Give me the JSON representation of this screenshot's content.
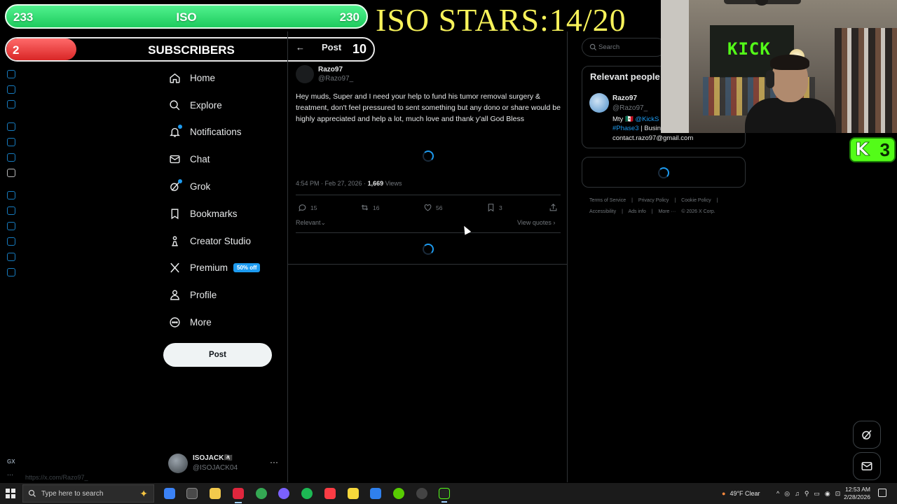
{
  "overlay": {
    "green_bar": {
      "left": "233",
      "center": "ISO",
      "right": "230"
    },
    "red_bar": {
      "left": "2",
      "center": "SUBSCRIBERS"
    },
    "stars_text": "ISO STARS:14/20",
    "kick_badge": {
      "count": "3"
    }
  },
  "header": {
    "back_icon": "arrow-left-icon",
    "title": "Post",
    "count": "10"
  },
  "nav": {
    "items": [
      {
        "label": "Home",
        "icon": "home-icon"
      },
      {
        "label": "Explore",
        "icon": "search-icon"
      },
      {
        "label": "Notifications",
        "icon": "bell-icon"
      },
      {
        "label": "Chat",
        "icon": "mail-icon"
      },
      {
        "label": "Grok",
        "icon": "grok-icon"
      },
      {
        "label": "Bookmarks",
        "icon": "bookmark-icon"
      },
      {
        "label": "Creator Studio",
        "icon": "creator-icon"
      },
      {
        "label": "Premium",
        "icon": "x-logo-icon",
        "badge": "50% off"
      },
      {
        "label": "Profile",
        "icon": "person-icon"
      },
      {
        "label": "More",
        "icon": "more-circle-icon"
      }
    ],
    "post_button": "Post"
  },
  "account": {
    "name": "ISOJACK🏴‍☠️",
    "handle": "@ISOJACK04",
    "more": "···"
  },
  "status_url": "https://x.com/Razo97_",
  "post": {
    "author_name": "Razo97",
    "author_handle": "@Razo97_",
    "text": "Hey muds, Super and I need your help to fund his tumor removal surgery & treatment, don't feel pressured to sent something but any dono or share would be highly appreciated and help a lot, much love and thank y'all God Bless",
    "time": "4:54 PM · Feb 27, 2026 · ",
    "views_count": "1,669",
    "views_label": " Views",
    "replies": "15",
    "reposts": "16",
    "likes": "56",
    "bookmarks": "3",
    "sort_label": "Relevant",
    "view_quotes": "View quotes"
  },
  "sidebar_right": {
    "search_placeholder": "Search",
    "relevant_title": "Relevant people",
    "person": {
      "name": "Razo97",
      "handle": "@Razo97_",
      "bio_prefix": "Mty 🇲🇽 ",
      "bio_link1": "@KickS",
      "bio_link2": "#Phase3",
      "bio_suffix": " | Busin",
      "bio_email": "contact.razo97@gmail.com"
    },
    "footer_row1": [
      "Terms of Service",
      "|",
      "Privacy Policy",
      "|",
      "Cookie Policy",
      "|"
    ],
    "footer_row2": [
      "Accessibility",
      "|",
      "Ads info",
      "|",
      "More ···",
      "© 2026 X Corp."
    ]
  },
  "taskbar": {
    "search_placeholder": "Type here to search",
    "weather": "49°F  Clear",
    "time": "12:53 AM",
    "date": "2/28/2026"
  },
  "colors": {
    "accent": "#1d9bf0",
    "green_bar": "#1ecb5e",
    "red_bar": "#d92626",
    "stars_text": "#f7f25a",
    "kick_green": "#53fc18"
  }
}
